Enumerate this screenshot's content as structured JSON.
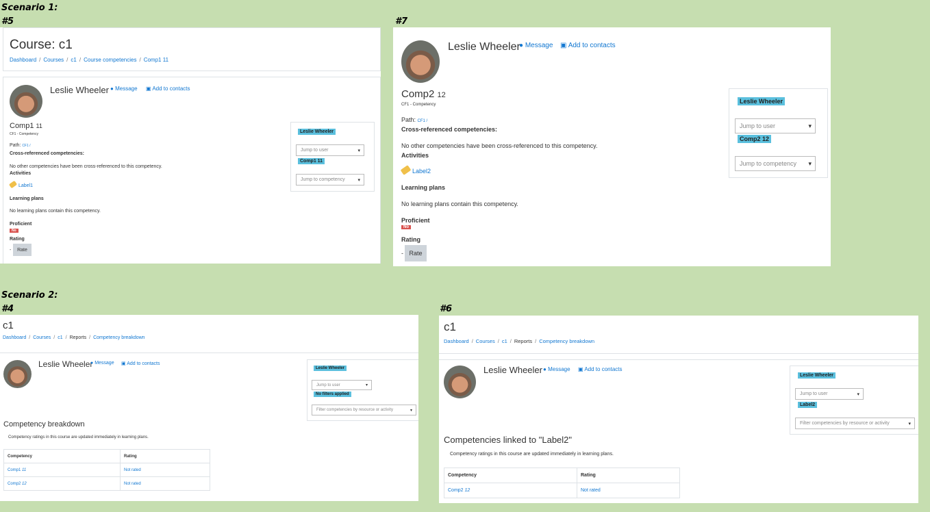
{
  "scenario1": {
    "heading": "Scenario 1:",
    "p5": {
      "label": "#5",
      "page_title": "Course: c1",
      "breadcrumb": [
        "Dashboard",
        "Courses",
        "c1",
        "Course competencies",
        "Comp1 11"
      ],
      "user_name": "Leslie Wheeler",
      "message": "Message",
      "add_contacts": "Add to contacts",
      "comp_name": "Comp1",
      "comp_id": "11",
      "framework": "CF1 - Competency",
      "path_label": "Path:",
      "path_value": "CF1 /",
      "xref_title": "Cross-referenced competencies:",
      "xref_text": "No other competencies have been cross-referenced to this competency.",
      "activities_title": "Activities",
      "activity_link": "Label1",
      "plans_title": "Learning plans",
      "plans_text": "No learning plans contain this competency.",
      "proficient_title": "Proficient",
      "proficient_value": "No",
      "rating_title": "Rating",
      "rating_value": "-",
      "rate_button": "Rate",
      "nav_user_badge": "Leslie Wheeler",
      "jump_user": "Jump to user",
      "nav_comp_badge": "Comp1 11",
      "jump_comp": "Jump to competency"
    },
    "p7": {
      "label": "#7",
      "user_name": "Leslie Wheeler",
      "message": "Message",
      "add_contacts": "Add to contacts",
      "comp_name": "Comp2",
      "comp_id": "12",
      "framework": "CF1 - Competency",
      "path_label": "Path:",
      "path_value": "CF1 /",
      "xref_title": "Cross-referenced competencies:",
      "xref_text": "No other competencies have been cross-referenced to this competency.",
      "activities_title": "Activities",
      "activity_link": "Label2",
      "plans_title": "Learning plans",
      "plans_text": "No learning plans contain this competency.",
      "proficient_title": "Proficient",
      "proficient_value": "No",
      "rating_title": "Rating",
      "rating_value": "-",
      "rate_button": "Rate",
      "nav_user_badge": "Leslie Wheeler",
      "jump_user": "Jump to user",
      "nav_comp_badge": "Comp2 12",
      "jump_comp": "Jump to competency"
    }
  },
  "scenario2": {
    "heading": "Scenario 2:",
    "p4": {
      "label": "#4",
      "page_title": "c1",
      "breadcrumb": [
        "Dashboard",
        "Courses",
        "c1",
        "Reports",
        "Competency breakdown"
      ],
      "user_name": "Leslie Wheeler",
      "message": "Message",
      "add_contacts": "Add to contacts",
      "nav_user_badge": "Leslie Wheeler",
      "jump_user": "Jump to user",
      "filter_badge": "No filters applied",
      "filter_select": "Filter competencies by resource or activity",
      "section_title": "Competency breakdown",
      "note": "Competency ratings in this course are updated immediately in learning plans.",
      "table_headers": [
        "Competency",
        "Rating"
      ],
      "rows": [
        {
          "name": "Comp1",
          "id": "11",
          "rating": "Not rated"
        },
        {
          "name": "Comp2",
          "id": "12",
          "rating": "Not rated"
        }
      ]
    },
    "p6": {
      "label": "#6",
      "page_title": "c1",
      "breadcrumb": [
        "Dashboard",
        "Courses",
        "c1",
        "Reports",
        "Competency breakdown"
      ],
      "user_name": "Leslie Wheeler",
      "message": "Message",
      "add_contacts": "Add to contacts",
      "nav_user_badge": "Leslie Wheeler",
      "jump_user": "Jump to user",
      "filter_badge": "Label2",
      "filter_select": "Filter competencies by resource or activity",
      "section_title": "Competencies linked to \"Label2\"",
      "note": "Competency ratings in this course are updated immediately in learning plans.",
      "table_headers": [
        "Competency",
        "Rating"
      ],
      "rows": [
        {
          "name": "Comp2",
          "id": "12",
          "rating": "Not rated"
        }
      ]
    }
  },
  "colors": {
    "background": "#c6deb0",
    "link": "#1177d1",
    "badge_info": "#5bc0de",
    "badge_danger": "#d9534f",
    "rate_button": "#ced4da"
  }
}
